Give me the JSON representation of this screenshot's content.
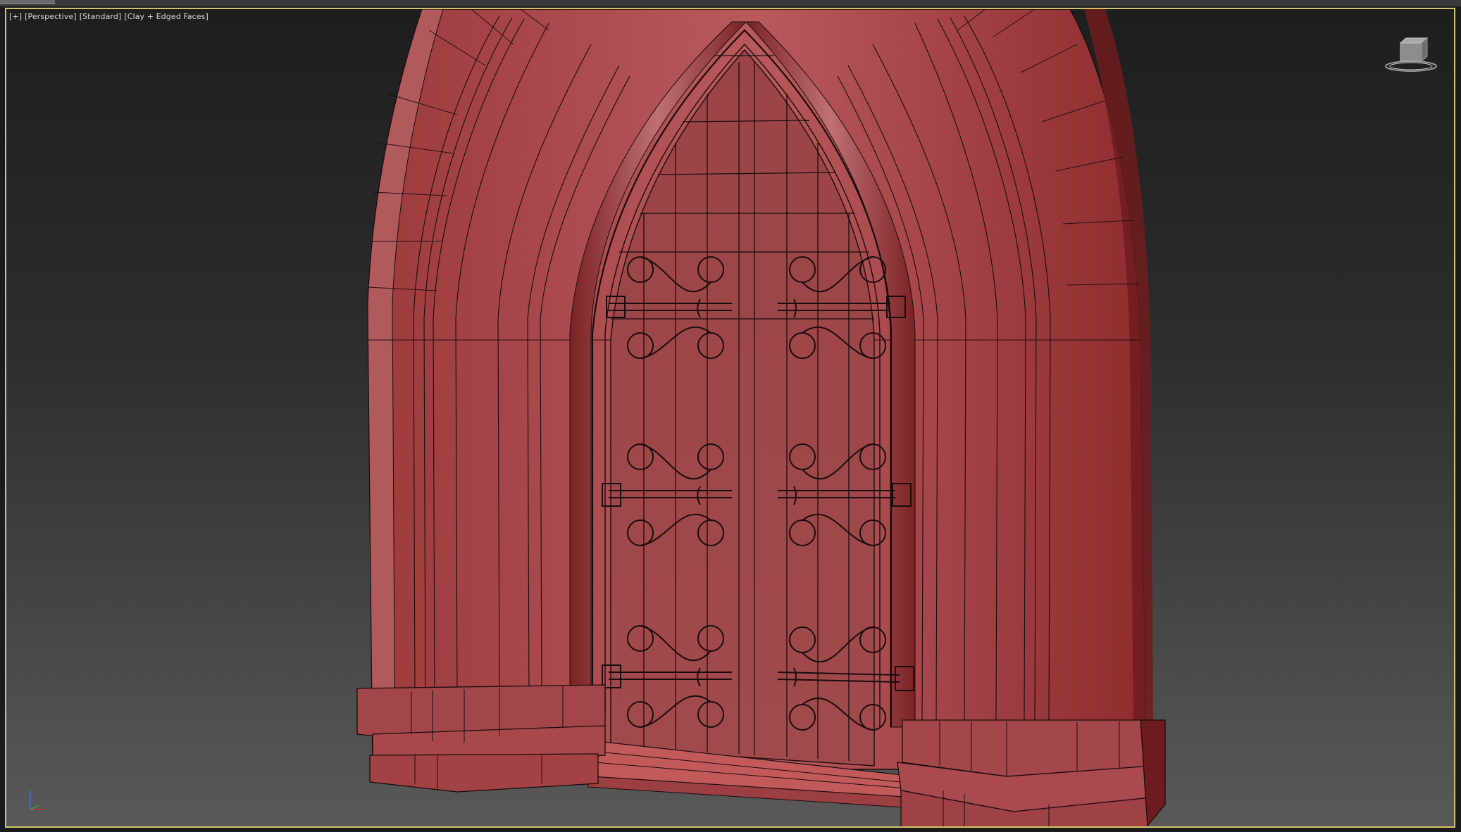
{
  "viewport": {
    "labels": {
      "plus": "[+]",
      "view": "[Perspective]",
      "shading_preset": "[Standard]",
      "render_mode": "[Clay + Edged Faces]"
    }
  },
  "viewcube": {
    "icon": "viewcube-icon"
  },
  "axis_tripod": {
    "icon": "axis-tripod-icon"
  },
  "model": {
    "name": "gothic-arch-door",
    "color": "#a6474a"
  },
  "colors": {
    "frame": "#d3c46a",
    "clay": "#a6474a",
    "clay_dark": "#6b1b1c",
    "edge": "#1a0c0c"
  }
}
